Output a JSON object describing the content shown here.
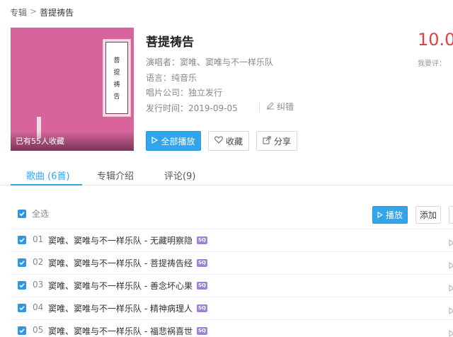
{
  "breadcrumb": {
    "parent": "专辑",
    "separator": ">",
    "current": "菩提祷告"
  },
  "cover": {
    "card_chars": [
      "菩",
      "提",
      "祷",
      "告"
    ],
    "favorites": "已有55人收藏",
    "color": "#d7649d"
  },
  "album": {
    "title": "菩提祷告",
    "singer_label": "演唱者：",
    "singer_value": "窦唯、窦唯与不一样乐队",
    "language_label": "语言：",
    "language_value": "纯音乐",
    "company_label": "唱片公司：",
    "company_value": "独立发行",
    "date_label": "发行时间：",
    "date_value": "2019-09-05",
    "report_label": "纠错"
  },
  "actions": {
    "play_all": "全部播放",
    "favorite": "收藏",
    "share": "分享"
  },
  "score": {
    "value": "10.0",
    "rate_label": "我要评："
  },
  "tabs": [
    {
      "label": "歌曲 (6首)",
      "active": true
    },
    {
      "label": "专辑介绍",
      "active": false
    },
    {
      "label": "评论(9)",
      "active": false
    }
  ],
  "list": {
    "select_all": "全选",
    "play": "播放",
    "add": "添加"
  },
  "songs": [
    {
      "num": "01",
      "title": "窦唯、窦唯与不一样乐队 - 无藏明察隐",
      "badge": "SQ"
    },
    {
      "num": "02",
      "title": "窦唯、窦唯与不一样乐队 - 菩提祷告经",
      "badge": "SQ"
    },
    {
      "num": "03",
      "title": "窦唯、窦唯与不一样乐队 - 善念坏心果",
      "badge": "SQ"
    },
    {
      "num": "04",
      "title": "窦唯、窦唯与不一样乐队 - 精神病理人",
      "badge": "SQ"
    },
    {
      "num": "05",
      "title": "窦唯、窦唯与不一样乐队 - 福悲祸喜世",
      "badge": "SQ"
    }
  ],
  "colors": {
    "accent": "#31a5ec",
    "score": "#e53f3f",
    "badge": "#9b82d6"
  }
}
